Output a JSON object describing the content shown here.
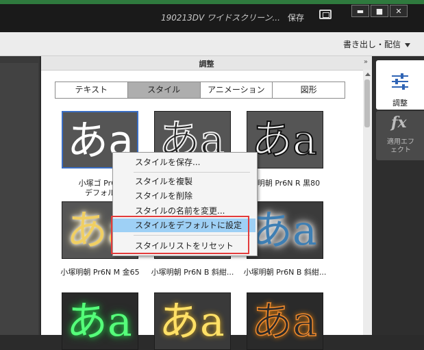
{
  "window": {
    "project_title": "190213DV ワイドスクリーン...",
    "save_label": "保存",
    "controls": {
      "minimize": "▬",
      "maximize": "■",
      "close": "✕"
    }
  },
  "toolbar": {
    "export_label": "書き出し・配信"
  },
  "panel": {
    "title": "調整",
    "tabs": [
      {
        "label": "テキスト",
        "active": false
      },
      {
        "label": "スタイル",
        "active": true
      },
      {
        "label": "アニメーション",
        "active": false
      },
      {
        "label": "図形",
        "active": false
      }
    ]
  },
  "styles": [
    {
      "glyph": "あa",
      "label": "小塚ゴ Pr6N",
      "label2": "デフォル",
      "selected": true
    },
    {
      "glyph": "あa",
      "label": ""
    },
    {
      "glyph": "あa",
      "label": "塚明朝 Pr6N R 黒80"
    },
    {
      "glyph": "あa",
      "label": "小塚明朝 Pr6N M 金65"
    },
    {
      "glyph": "あa",
      "label": "小塚明朝 Pr6N B 斜紺..."
    },
    {
      "glyph": "あa",
      "label": "小塚明朝 Pr6N B 斜紺..."
    },
    {
      "glyph": "あa",
      "label": ""
    },
    {
      "glyph": "あa",
      "label": ""
    },
    {
      "glyph": "あa",
      "label": ""
    }
  ],
  "context_menu": {
    "items": [
      {
        "label": "スタイルを保存..."
      },
      {
        "label": "スタイルを複製"
      },
      {
        "label": "スタイルを削除"
      },
      {
        "label": "スタイルの名前を変更..."
      },
      {
        "label": "スタイルをデフォルトに設定",
        "highlighted": true
      },
      {
        "label": "スタイルリストをリセット"
      }
    ]
  },
  "side_panel": {
    "adjust_label": "調整",
    "effects_label": "適用エフェクト",
    "effects_icon": "fx"
  },
  "colors": {
    "highlight": "#9ed0f5",
    "annotation_box": "#e33b3b",
    "title_bar_accent": "#2f7a3e"
  }
}
